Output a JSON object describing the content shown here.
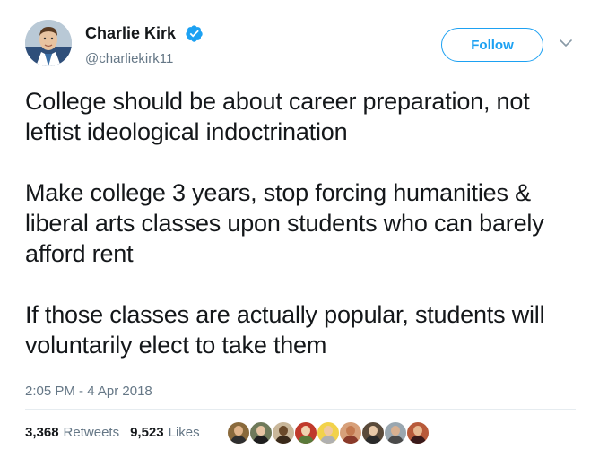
{
  "author": {
    "display_name": "Charlie Kirk",
    "handle": "@charliekirk11",
    "verified": true,
    "avatar_icon": "profile-photo"
  },
  "actions": {
    "follow_label": "Follow",
    "more_icon": "chevron-down-icon"
  },
  "tweet": {
    "paragraphs": [
      "College should be about career preparation, not leftist ideological indoctrination",
      "Make college 3 years, stop forcing humanities & liberal arts classes upon students who can barely afford rent",
      "If those classes are actually popular, students will voluntarily elect to take them"
    ],
    "timestamp": "2:05 PM - 4 Apr 2018"
  },
  "stats": {
    "retweets_count": "3,368",
    "retweets_label": "Retweets",
    "likes_count": "9,523",
    "likes_label": "Likes"
  },
  "likers": [
    {
      "bg": "#8a6a3c",
      "skin": "#e0b48a",
      "shirt": "#2f2f2f"
    },
    {
      "bg": "#6f7a5a",
      "skin": "#e6c4a2",
      "shirt": "#1e1e1e"
    },
    {
      "bg": "#c9b79a",
      "skin": "#6b4a2a",
      "shirt": "#3a2a1a"
    },
    {
      "bg": "#c0392b",
      "skin": "#f0d2b0",
      "shirt": "#5a7a3a"
    },
    {
      "bg": "#f2d24a",
      "skin": "#f0c8a0",
      "shirt": "#b0b0b0"
    },
    {
      "bg": "#d7a07a",
      "skin": "#c47a50",
      "shirt": "#8a3a2a"
    },
    {
      "bg": "#5a4a3a",
      "skin": "#e8c8a8",
      "shirt": "#2a2a2a"
    },
    {
      "bg": "#9aa7b0",
      "skin": "#d8b090",
      "shirt": "#4a4a4a"
    },
    {
      "bg": "#b85a3a",
      "skin": "#e8b890",
      "shirt": "#3a1a1a"
    }
  ],
  "colors": {
    "accent": "#1da1f2",
    "text": "#14171a",
    "muted": "#657786",
    "divider": "#e6ecf0"
  }
}
